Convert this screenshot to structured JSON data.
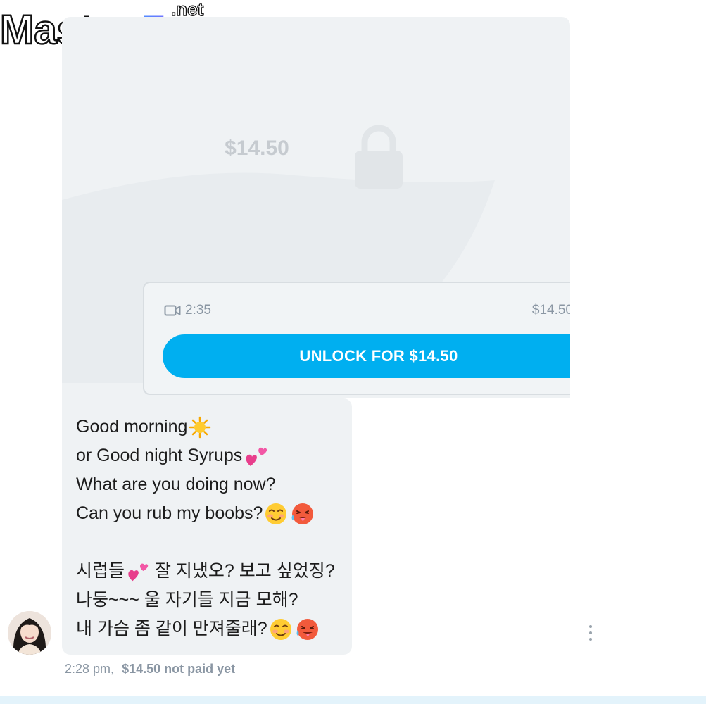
{
  "watermark": {
    "brand_left": "Master",
    "brand_right": "Fap",
    "suffix": ".net"
  },
  "media": {
    "overlay_price": "$14.50",
    "duration": "2:35",
    "price": "$14.50",
    "unlock_label": "UNLOCK FOR $14.50",
    "video_icon": "video-camera-icon",
    "lock_icon": "lock-icon"
  },
  "message": {
    "lines": [
      "Good morning",
      "or Good night Syrups",
      "What are you doing now?",
      "Can you rub my boobs?",
      "시럽들",
      " 잘 지냈오? 보고 싶었징?",
      "나둥~~~ 울 자기들 지금 모해?",
      "내 가슴 좀 같이 만져줄래?"
    ],
    "time": "2:28 pm,",
    "payment_status": "$14.50 not paid yet"
  },
  "colors": {
    "accent": "#00aff0",
    "bubble": "#eff2f4",
    "muted": "#8a96a3"
  }
}
